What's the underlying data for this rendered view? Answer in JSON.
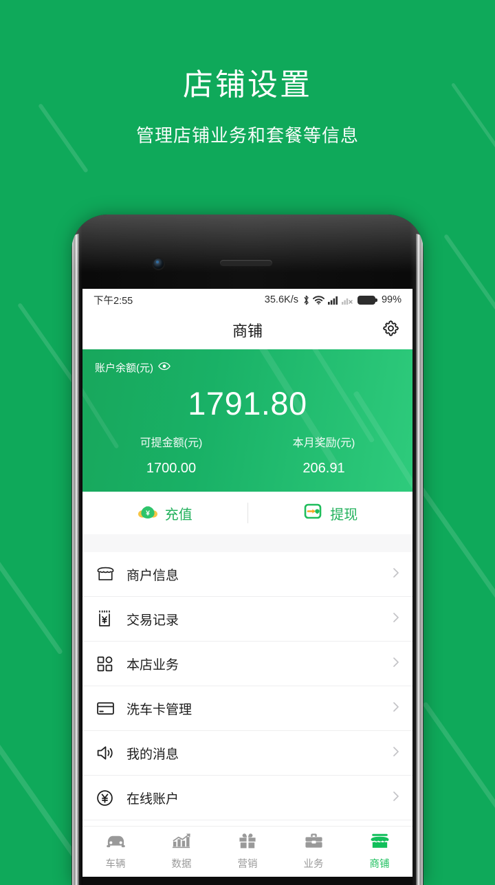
{
  "hero": {
    "title": "店铺设置",
    "subtitle": "管理店铺业务和套餐等信息"
  },
  "colors": {
    "backdrop": "#0fa95a",
    "brand_green": "#22b15c",
    "accent_green": "#1ec05f",
    "card_gradient_from": "#18a75c",
    "card_gradient_to": "#2ecb7c"
  },
  "statusbar": {
    "time": "下午2:55",
    "network_speed": "35.6K/s",
    "battery_percent": "99%",
    "icons": [
      "bluetooth-icon",
      "wifi-icon",
      "signal-icon",
      "signal-off-icon",
      "battery-icon"
    ]
  },
  "appbar": {
    "title": "商铺",
    "settings_icon": "gear-icon"
  },
  "balance": {
    "label": "账户余额(元)",
    "eye_icon": "eye-icon",
    "amount": "1791.80",
    "columns": [
      {
        "label": "可提金额(元)",
        "value": "1700.00"
      },
      {
        "label": "本月奖励(元)",
        "value": "206.91"
      }
    ]
  },
  "actions": [
    {
      "label": "充值",
      "icon": "money-bag-icon"
    },
    {
      "label": "提现",
      "icon": "wallet-withdraw-icon"
    }
  ],
  "menu": [
    {
      "label": "商户信息",
      "icon": "shop-icon"
    },
    {
      "label": "交易记录",
      "icon": "receipt-yen-icon"
    },
    {
      "label": "本店业务",
      "icon": "grid-icon"
    },
    {
      "label": "洗车卡管理",
      "icon": "card-icon"
    },
    {
      "label": "我的消息",
      "icon": "speaker-icon"
    },
    {
      "label": "在线账户",
      "icon": "yen-circle-icon"
    }
  ],
  "tabbar": [
    {
      "label": "车辆",
      "icon": "car-icon",
      "active": false
    },
    {
      "label": "数据",
      "icon": "chart-icon",
      "active": false
    },
    {
      "label": "营销",
      "icon": "gift-icon",
      "active": false
    },
    {
      "label": "业务",
      "icon": "briefcase-icon",
      "active": false
    },
    {
      "label": "商铺",
      "icon": "shop-icon",
      "active": true
    }
  ]
}
